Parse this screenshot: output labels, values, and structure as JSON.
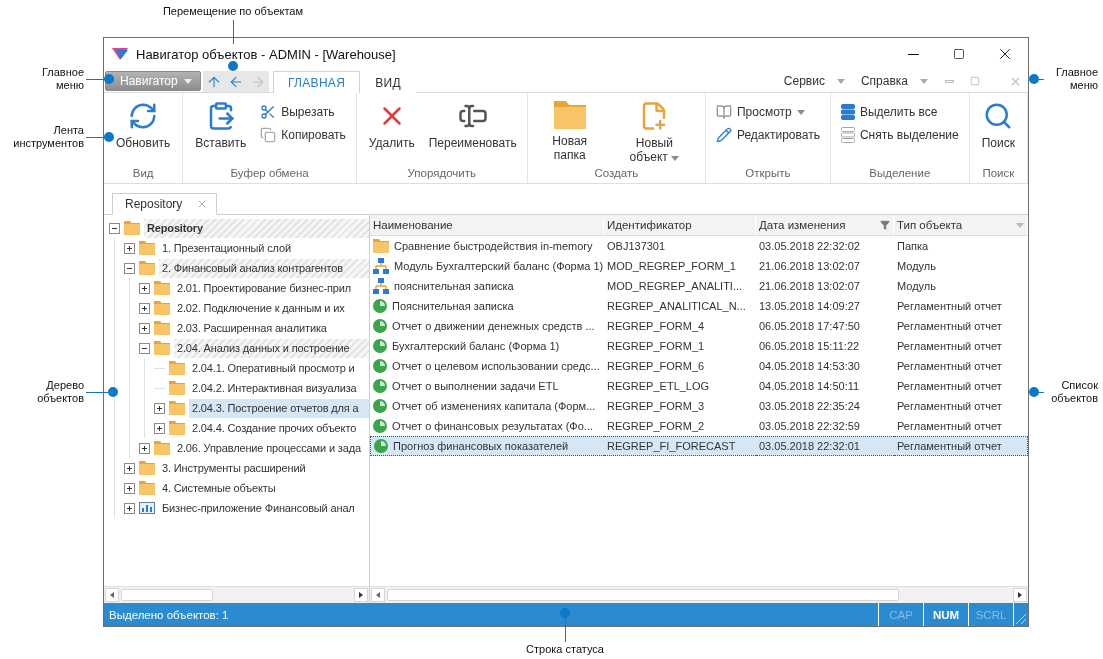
{
  "callouts": [
    {
      "text": "Перемещение по объектам"
    },
    {
      "text": "Главное меню"
    },
    {
      "text": "Лента инструментов"
    },
    {
      "text": "Дерево объектов"
    },
    {
      "text": "Главное меню"
    },
    {
      "text": "Список объектов"
    },
    {
      "text": "Строка статуса"
    }
  ],
  "window": {
    "title": "Навигатор объектов - ADMIN - [Warehouse]"
  },
  "main_menu": {
    "label": "Навигатор"
  },
  "nav_buttons": [
    {
      "disabled": false
    },
    {
      "disabled": false
    },
    {
      "disabled": true
    }
  ],
  "tabs": [
    {
      "label": "ГЛАВНАЯ",
      "selected": true
    },
    {
      "label": "ВИД",
      "selected": false
    }
  ],
  "menus": [
    {
      "label": "Сервис"
    },
    {
      "label": "Справка"
    }
  ],
  "ribbon": {
    "groups": [
      {
        "label": "Вид",
        "items": [
          {
            "label": "Обновить",
            "kind": "large",
            "dropdown": false
          }
        ]
      },
      {
        "label": "Буфер обмена",
        "items": [
          {
            "label": "Вставить",
            "kind": "large",
            "dropdown": false
          },
          {
            "label": "Вырезать",
            "kind": "small",
            "dropdown": false
          },
          {
            "label": "Копировать",
            "kind": "small",
            "dropdown": false
          }
        ]
      },
      {
        "label": "Упорядочить",
        "items": [
          {
            "label": "Удалить",
            "kind": "large",
            "dropdown": false
          },
          {
            "label": "Переименовать",
            "kind": "large",
            "dropdown": false
          }
        ]
      },
      {
        "label": "Создать",
        "items": [
          {
            "label": "Новая папка",
            "kind": "large",
            "dropdown": false
          },
          {
            "label": "Новый объект",
            "kind": "large",
            "dropdown": true
          }
        ]
      },
      {
        "label": "Открыть",
        "items": [
          {
            "label": "Просмотр",
            "kind": "small",
            "dropdown": true
          },
          {
            "label": "Редактировать",
            "kind": "small",
            "dropdown": false
          }
        ]
      },
      {
        "label": "Выделение",
        "items": [
          {
            "label": "Выделить все",
            "kind": "small",
            "dropdown": false
          },
          {
            "label": "Снять выделение",
            "kind": "small",
            "dropdown": false
          }
        ]
      },
      {
        "label": "Поиск",
        "items": [
          {
            "label": "Поиск",
            "kind": "large",
            "dropdown": false
          }
        ]
      }
    ]
  },
  "document_tabs": [
    {
      "label": "Repository",
      "selected": true
    }
  ],
  "tree": [
    {
      "label": "Repository",
      "kind": "folder",
      "expandable": true,
      "expanded": true,
      "selected": false,
      "on_path": true,
      "children": [
        {
          "label": "1. Презентационный слой",
          "kind": "folder",
          "expandable": true,
          "expanded": false,
          "selected": false,
          "on_path": false
        },
        {
          "label": "2. Финансовый анализ контрагентов",
          "kind": "folder",
          "expandable": true,
          "expanded": true,
          "selected": false,
          "on_path": true,
          "children": [
            {
              "label": "2.01. Проектирование бизнес-прил",
              "kind": "folder",
              "expandable": true,
              "expanded": false,
              "selected": false,
              "on_path": false
            },
            {
              "label": "2.02. Подключение к данным и их",
              "kind": "folder",
              "expandable": true,
              "expanded": false,
              "selected": false,
              "on_path": false
            },
            {
              "label": "2.03. Расширенная аналитика",
              "kind": "folder",
              "expandable": true,
              "expanded": false,
              "selected": false,
              "on_path": false
            },
            {
              "label": "2.04. Анализ данных и построение",
              "kind": "folder",
              "expandable": true,
              "expanded": true,
              "selected": false,
              "on_path": true,
              "children": [
                {
                  "label": "2.04.1. Оперативный просмотр и",
                  "kind": "folder",
                  "expandable": false,
                  "expanded": false,
                  "selected": false,
                  "on_path": false
                },
                {
                  "label": "2.04.2. Интерактивная визуализа",
                  "kind": "folder",
                  "expandable": false,
                  "expanded": false,
                  "selected": false,
                  "on_path": false
                },
                {
                  "label": "2.04.3. Построение отчетов для а",
                  "kind": "folder",
                  "expandable": true,
                  "expanded": false,
                  "selected": true,
                  "on_path": false
                },
                {
                  "label": "2.04.4. Создание прочих объекто",
                  "kind": "folder",
                  "expandable": true,
                  "expanded": false,
                  "selected": false,
                  "on_path": false
                }
              ]
            },
            {
              "label": "2.06. Управление процессами и зада",
              "kind": "folder",
              "expandable": true,
              "expanded": false,
              "selected": false,
              "on_path": false
            }
          ]
        },
        {
          "label": "3. Инструменты расширений",
          "kind": "folder",
          "expandable": true,
          "expanded": false,
          "selected": false,
          "on_path": false
        },
        {
          "label": "4. Системные объекты",
          "kind": "folder",
          "expandable": true,
          "expanded": false,
          "selected": false,
          "on_path": false
        },
        {
          "label": "Бизнес-приложение Финансовый анал",
          "kind": "application",
          "expandable": true,
          "expanded": false,
          "selected": false,
          "on_path": false
        }
      ]
    }
  ],
  "list": {
    "columns": [
      {
        "label": "Наименование",
        "filter": false
      },
      {
        "label": "Идентификатор",
        "filter": false
      },
      {
        "label": "Дата изменения",
        "filter": true
      },
      {
        "label": "Тип объекта",
        "filter": false
      }
    ],
    "rows": [
      {
        "kind": "folder",
        "name": "Сравнение быстродействия in-memory",
        "id": "OBJ137301",
        "modified": "03.05.2018 22:32:02",
        "type": "Папка",
        "selected": false
      },
      {
        "kind": "module",
        "name": "Модуль Бухгалтерский баланс (Форма 1)",
        "id": "MOD_REGREP_FORM_1",
        "modified": "21.06.2018 13:02:07",
        "type": "Модуль",
        "selected": false
      },
      {
        "kind": "module",
        "name": "пояснительная записка",
        "id": "MOD_REGREP_ANALITI...",
        "modified": "21.06.2018 13:02:07",
        "type": "Модуль",
        "selected": false
      },
      {
        "kind": "report",
        "name": "Пояснительная записка",
        "id": "REGREP_ANALITICAL_N...",
        "modified": "13.05.2018 14:09:27",
        "type": "Регламентный отчет",
        "selected": false
      },
      {
        "kind": "report",
        "name": "Отчет о движении денежных средств ...",
        "id": "REGREP_FORM_4",
        "modified": "06.05.2018 17:47:50",
        "type": "Регламентный отчет",
        "selected": false
      },
      {
        "kind": "report",
        "name": "Бухгалтерский баланс (Форма 1)",
        "id": "REGREP_FORM_1",
        "modified": "06.05.2018 15:11:22",
        "type": "Регламентный отчет",
        "selected": false
      },
      {
        "kind": "report",
        "name": "Отчет о целевом использовании средс...",
        "id": "REGREP_FORM_6",
        "modified": "04.05.2018 14:53:30",
        "type": "Регламентный отчет",
        "selected": false
      },
      {
        "kind": "report",
        "name": "Отчет о выполнении задачи ETL",
        "id": "REGREP_ETL_LOG",
        "modified": "04.05.2018 14:50:11",
        "type": "Регламентный отчет",
        "selected": false
      },
      {
        "kind": "report",
        "name": "Отчет об изменениях капитала (Форм...",
        "id": "REGREP_FORM_3",
        "modified": "03.05.2018 22:35:24",
        "type": "Регламентный отчет",
        "selected": false
      },
      {
        "kind": "report",
        "name": "Отчет о финансовых результатах (Фо...",
        "id": "REGREP_FORM_2",
        "modified": "03.05.2018 22:32:59",
        "type": "Регламентный отчет",
        "selected": false
      },
      {
        "kind": "report",
        "name": "Прогноз финансовых показателей",
        "id": "REGREP_FI_FORECAST",
        "modified": "03.05.2018 22:32:01",
        "type": "Регламентный отчет",
        "selected": true
      }
    ]
  },
  "status_bar": {
    "text": "Выделено объектов: 1",
    "indicators": [
      {
        "label": "CAP",
        "on": false
      },
      {
        "label": "NUM",
        "on": true
      },
      {
        "label": "SCRL",
        "on": false
      }
    ]
  }
}
